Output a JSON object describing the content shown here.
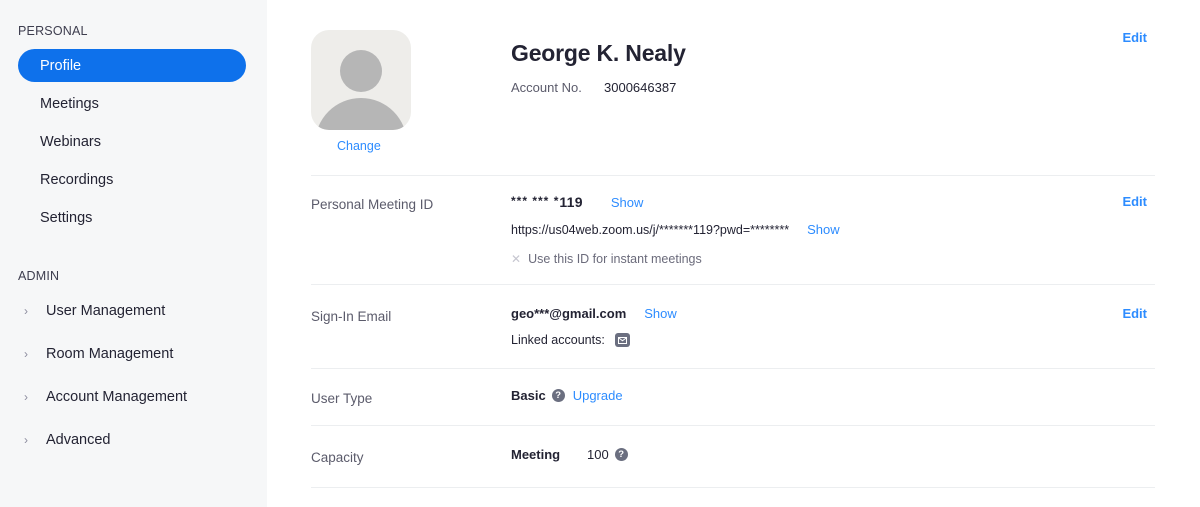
{
  "colors": {
    "accent": "#0e71eb",
    "link": "#2d8cff",
    "sidebar_bg": "#f6f7f8",
    "text": "#232333",
    "muted": "#5b5b6b",
    "divider": "#eceef0"
  },
  "sidebar": {
    "personal": {
      "title": "PERSONAL",
      "items": [
        {
          "label": "Profile",
          "active": true
        },
        {
          "label": "Meetings",
          "active": false
        },
        {
          "label": "Webinars",
          "active": false
        },
        {
          "label": "Recordings",
          "active": false
        },
        {
          "label": "Settings",
          "active": false
        }
      ]
    },
    "admin": {
      "title": "ADMIN",
      "chevron": "›",
      "items": [
        {
          "label": "User Management"
        },
        {
          "label": "Room Management"
        },
        {
          "label": "Account Management"
        },
        {
          "label": "Advanced"
        }
      ]
    }
  },
  "profile": {
    "avatar_change_label": "Change",
    "name": "George K. Nealy",
    "account_label": "Account No.",
    "account_number": "3000646387",
    "edit_label": "Edit"
  },
  "pmi": {
    "label": "Personal Meeting ID",
    "id_stars": "*** *** *",
    "id_digits": "119",
    "show_label": "Show",
    "url": "https://us04web.zoom.us/j/*******119?pwd=********",
    "url_show_label": "Show",
    "instant_x": "✕",
    "instant_label": "Use this ID for instant meetings",
    "edit_label": "Edit"
  },
  "email": {
    "label": "Sign-In Email",
    "value": "geo***@gmail.com",
    "show_label": "Show",
    "linked_label": "Linked accounts:",
    "edit_label": "Edit"
  },
  "user_type": {
    "label": "User Type",
    "value": "Basic",
    "help_glyph": "?",
    "upgrade_label": "Upgrade"
  },
  "capacity": {
    "label": "Capacity",
    "type": "Meeting",
    "value": "100",
    "help_glyph": "?"
  }
}
